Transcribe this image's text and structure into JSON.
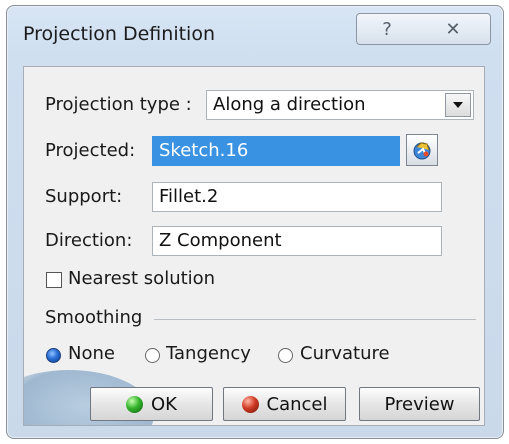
{
  "window": {
    "title": "Projection Definition",
    "help_glyph": "?",
    "close_glyph": "✕"
  },
  "form": {
    "projection_type_label": "Projection type :",
    "projection_type_value": "Along a direction",
    "projected_label": "Projected:",
    "projected_value": "Sketch.16",
    "support_label": "Support:",
    "support_value": "Fillet.2",
    "direction_label": "Direction:",
    "direction_value": "Z Component",
    "nearest_label": "Nearest solution",
    "nearest_checked": false
  },
  "smoothing": {
    "group_label": "Smoothing",
    "options": [
      {
        "label": "None",
        "selected": true
      },
      {
        "label": "Tangency",
        "selected": false
      },
      {
        "label": "Curvature",
        "selected": false
      }
    ]
  },
  "buttons": {
    "ok": "OK",
    "cancel": "Cancel",
    "preview": "Preview"
  },
  "colors": {
    "selection": "#3a93e2",
    "ok_icon": "#34b32b",
    "cancel_icon": "#d03b24"
  }
}
